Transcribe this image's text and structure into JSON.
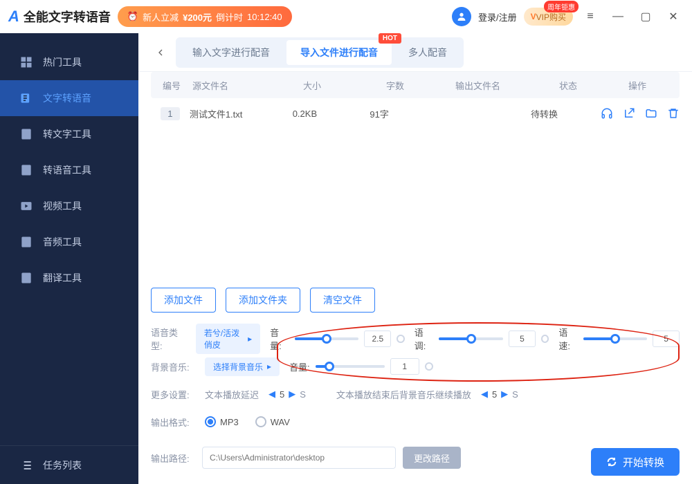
{
  "titlebar": {
    "app_name": "全能文字转语音",
    "promo_prefix": "新人立减",
    "promo_amount": "¥200元",
    "promo_countdown_label": "倒计时",
    "promo_countdown": "10:12:40",
    "login": "登录/注册",
    "vip": "VIP购买",
    "vip_badge": "周年钜惠"
  },
  "sidebar": {
    "items": [
      {
        "label": "热门工具"
      },
      {
        "label": "文字转语音"
      },
      {
        "label": "转文字工具"
      },
      {
        "label": "转语音工具"
      },
      {
        "label": "视频工具"
      },
      {
        "label": "音频工具"
      },
      {
        "label": "翻译工具"
      }
    ],
    "task_list": "任务列表"
  },
  "tabs": {
    "t0": "输入文字进行配音",
    "t1": "导入文件进行配音",
    "t2": "多人配音",
    "hot": "HOT"
  },
  "table": {
    "headers": {
      "idx": "编号",
      "src": "源文件名",
      "size": "大小",
      "chars": "字数",
      "out": "输出文件名",
      "status": "状态",
      "ops": "操作"
    },
    "rows": [
      {
        "idx": "1",
        "src": "测试文件1.txt",
        "size": "0.2KB",
        "chars": "91字",
        "out": "",
        "status": "待转换"
      }
    ]
  },
  "actions": {
    "add_file": "添加文件",
    "add_folder": "添加文件夹",
    "clear": "清空文件"
  },
  "settings": {
    "voice_type_label": "语音类型:",
    "voice_type_value": "若兮/活泼俏皮",
    "volume_label": "音量:",
    "volume_value": "2.5",
    "pitch_label": "语调:",
    "pitch_value": "5",
    "speed_label": "语速:",
    "speed_value": "5",
    "bgm_label": "背景音乐:",
    "bgm_value": "选择背景音乐",
    "bgm_volume_label": "音量:",
    "bgm_volume_value": "1",
    "more_label": "更多设置:",
    "delay_label": "文本播放延迟",
    "delay_value": "5",
    "delay_unit": "S",
    "after_label": "文本播放结束后背景音乐继续播放",
    "after_value": "5",
    "after_unit": "S",
    "format_label": "输出格式:",
    "format_mp3": "MP3",
    "format_wav": "WAV",
    "path_label": "输出路径:",
    "path_placeholder": "C:\\Users\\Administrator\\desktop",
    "path_btn": "更改路径",
    "start_btn": "开始转换"
  }
}
